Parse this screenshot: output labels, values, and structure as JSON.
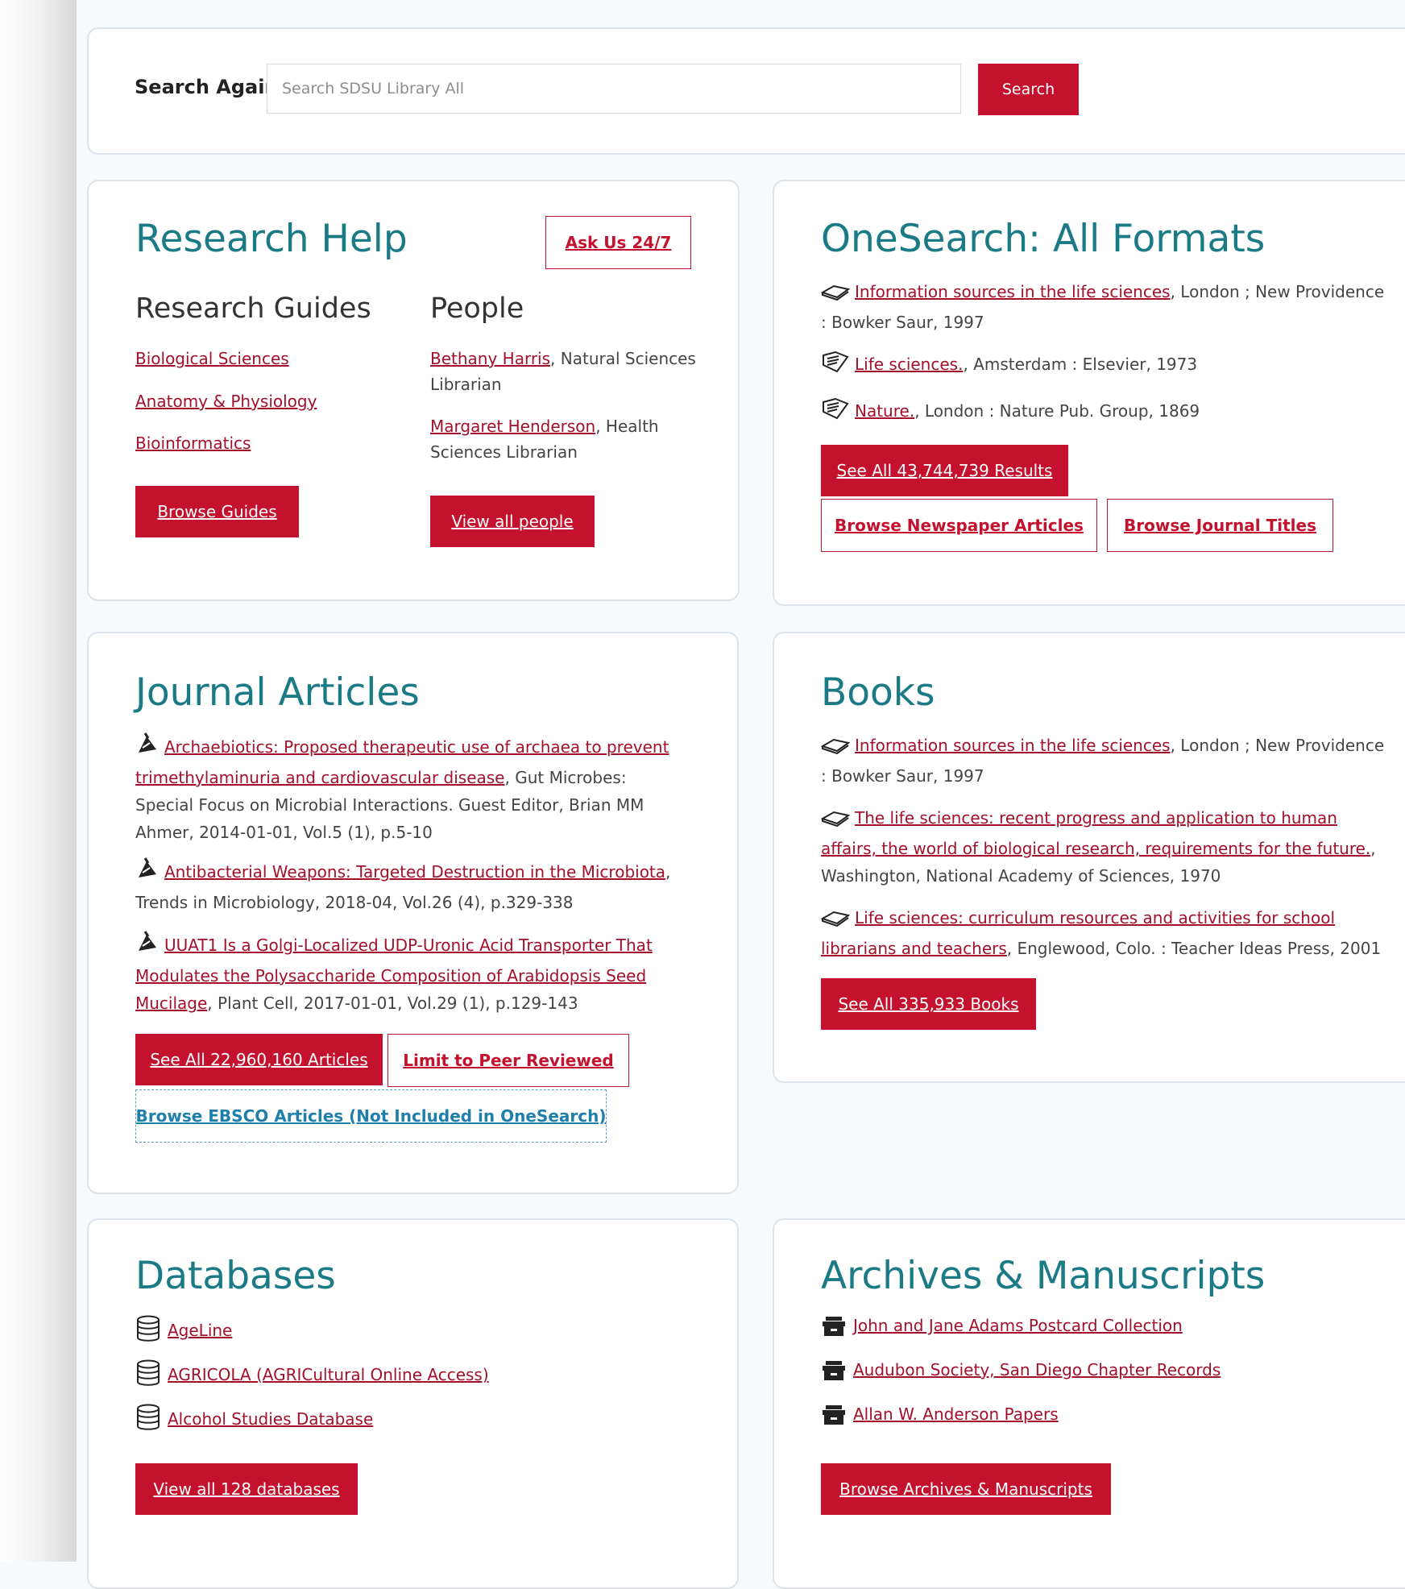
{
  "search": {
    "label": "Search Again",
    "placeholder": "Search SDSU Library All",
    "button": "Search"
  },
  "research_help": {
    "title": "Research Help",
    "ask_button": "Ask Us 24/7",
    "guides_heading": "Research Guides",
    "guides": [
      "Biological Sciences",
      "Anatomy & Physiology",
      "Bioinformatics"
    ],
    "browse_guides": "Browse Guides",
    "people_heading": "People",
    "people": [
      {
        "name": "Bethany Harris",
        "role": ", Natural Sciences Librarian"
      },
      {
        "name": "Margaret Henderson",
        "role": ", Health Sciences Librarian"
      }
    ],
    "view_people": "View all people"
  },
  "onesearch": {
    "title": "OneSearch: All Formats",
    "items": [
      {
        "icon": "book-icon",
        "link": "Information sources in the life sciences",
        "rest": ", London ; New Providence : Bowker Saur, 1997"
      },
      {
        "icon": "journal-icon",
        "link": "Life sciences.",
        "rest": ", Amsterdam : Elsevier, 1973"
      },
      {
        "icon": "journal-icon",
        "link": "Nature.",
        "rest": ", London : Nature Pub. Group, 1869"
      }
    ],
    "see_all": "See All 43,744,739 Results",
    "browse_newspaper": "Browse Newspaper Articles",
    "browse_journals": "Browse Journal Titles"
  },
  "journal_articles": {
    "title": "Journal Articles",
    "items": [
      {
        "icon": "article-icon",
        "link": "Archaebiotics: Proposed therapeutic use of archaea to prevent trimethylaminuria and cardiovascular disease",
        "rest": ", Gut Microbes: Special Focus on Microbial Interactions. Guest Editor, Brian MM Ahmer, 2014-01-01, Vol.5 (1), p.5-10"
      },
      {
        "icon": "article-icon",
        "link": "Antibacterial Weapons: Targeted Destruction in the Microbiota",
        "rest": ", Trends in Microbiology, 2018-04, Vol.26 (4), p.329-338"
      },
      {
        "icon": "article-icon",
        "link": "UUAT1 Is a Golgi-Localized UDP-Uronic Acid Transporter That Modulates the Polysaccharide Composition of Arabidopsis Seed Mucilage",
        "rest": ", Plant Cell, 2017-01-01, Vol.29 (1), p.129-143"
      }
    ],
    "see_all": "See All 22,960,160 Articles",
    "peer_reviewed": "Limit to Peer Reviewed",
    "ebsco": "Browse EBSCO Articles (Not Included in OneSearch)"
  },
  "books": {
    "title": "Books",
    "items": [
      {
        "icon": "book-icon",
        "link": "Information sources in the life sciences",
        "rest": ", London ; New Providence : Bowker Saur, 1997"
      },
      {
        "icon": "book-icon",
        "link": "The life sciences: recent progress and application to human affairs, the world of biological research, requirements for the future.",
        "rest": ", Washington, National Academy of Sciences, 1970"
      },
      {
        "icon": "book-icon",
        "link": "Life sciences: curriculum resources and activities for school librarians and teachers",
        "rest": ", Englewood, Colo. : Teacher Ideas Press, 2001"
      }
    ],
    "see_all": "See All 335,933 Books"
  },
  "databases": {
    "title": "Databases",
    "items": [
      "AgeLine",
      "AGRICOLA (AGRICultural Online Access)",
      "Alcohol Studies Database"
    ],
    "view_all": "View all 128 databases"
  },
  "archives": {
    "title": "Archives & Manuscripts",
    "items": [
      "John and Jane Adams Postcard Collection",
      "Audubon Society, San Diego Chapter Records",
      "Allan W. Anderson Papers"
    ],
    "browse": "Browse Archives & Manuscripts"
  },
  "colors": {
    "accent_red": "#c4112e",
    "title_teal": "#1a7a86",
    "link_red": "#a3102a",
    "ebsco_blue": "#1e7fab"
  }
}
